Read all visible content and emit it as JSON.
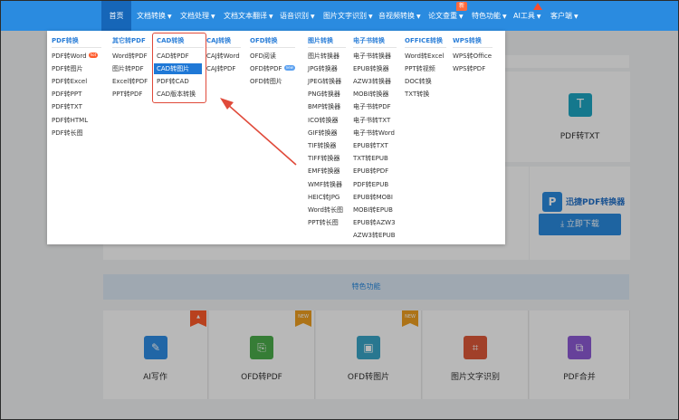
{
  "nav": {
    "items": [
      {
        "label": "首页",
        "active": true
      },
      {
        "label": "文档转换",
        "caret": true
      },
      {
        "label": "文档处理",
        "caret": true
      },
      {
        "label": "文档文本翻译",
        "caret": true
      },
      {
        "label": "语音识别",
        "caret": true
      },
      {
        "label": "图片文字识别",
        "caret": true
      },
      {
        "label": "音视频转换",
        "caret": true
      },
      {
        "label": "论文查重",
        "caret": true,
        "badge": "新"
      },
      {
        "label": "特色功能",
        "caret": true
      },
      {
        "label": "AI工具",
        "caret": true,
        "badge": "hot"
      },
      {
        "label": "客户端",
        "caret": true
      }
    ]
  },
  "dropdown": {
    "columns": [
      {
        "title": "PDF转换",
        "items": [
          "PDF转Word",
          "PDF转图片",
          "PDF转Excel",
          "PDF转PPT",
          "PDF转TXT",
          "PDF转HTML",
          "PDF转长图"
        ],
        "hot_index": 0
      },
      {
        "title": "其它转PDF",
        "items": [
          "Word转PDF",
          "图片转PDF",
          "Excel转PDF",
          "PPT转PDF"
        ]
      },
      {
        "title": "CAD转换",
        "items": [
          "CAD转PDF",
          "CAD转图片",
          "PDF转CAD",
          "CAD版本转换"
        ],
        "selected_index": 1
      },
      {
        "title": "CAJ转换",
        "items": [
          "CAJ转Word",
          "CAJ转PDF"
        ]
      },
      {
        "title": "OFD转换",
        "items": [
          "OFD阅读",
          "OFD转PDF",
          "OFD转图片"
        ],
        "new_index": 1
      },
      {
        "title": "图片转换",
        "items": [
          "图片转换器",
          "JPG转换器",
          "JPEG转换器",
          "PNG转换器",
          "BMP转换器",
          "ICO转换器",
          "GIF转换器",
          "TIF转换器",
          "TIFF转换器",
          "EMF转换器",
          "WMF转换器",
          "HEIC转JPG",
          "Word转长图",
          "PPT转长图"
        ]
      },
      {
        "title": "电子书转换",
        "items": [
          "电子书转换器",
          "EPUB转换器",
          "AZW3转换器",
          "MOBI转换器",
          "电子书转PDF",
          "电子书转TXT",
          "电子书转Word",
          "EPUB转TXT",
          "TXT转EPUB",
          "EPUB转PDF",
          "PDF转EPUB",
          "EPUB转MOBI",
          "MOBI转EPUB",
          "EPUB转AZW3",
          "AZW3转EPUB"
        ]
      },
      {
        "title": "OFFICE转换",
        "items": [
          "Word转Excel",
          "PPT转视频",
          "DOC转换",
          "TXT转换"
        ]
      },
      {
        "title": "WPS转换",
        "items": [
          "WPS转Office",
          "WPS转PDF"
        ]
      }
    ],
    "hot_tag": "hot",
    "new_tag": "new"
  },
  "background": {
    "pdf_txt_label": "PDF转TXT",
    "brand_name": "迅捷PDF转换器",
    "download_label": "立即下载",
    "features_title": "特色功能",
    "tiles": [
      {
        "label": "AI写作",
        "icon": "pencil-icon",
        "color": "#2f8ee6",
        "ribbon": "hot"
      },
      {
        "label": "OFD转PDF",
        "icon": "pdf-icon",
        "color": "#4cae4c",
        "ribbon": "NEW"
      },
      {
        "label": "OFD转图片",
        "icon": "image-icon",
        "color": "#3aa6c8",
        "ribbon": "NEW"
      },
      {
        "label": "图片文字识别",
        "icon": "ocr-icon",
        "color": "#e0593a"
      },
      {
        "label": "PDF合并",
        "icon": "merge-icon",
        "color": "#8e5bd6"
      }
    ],
    "ribbon_colors": {
      "hot": "#ff5a2a",
      "NEW": "#f0a020"
    }
  }
}
